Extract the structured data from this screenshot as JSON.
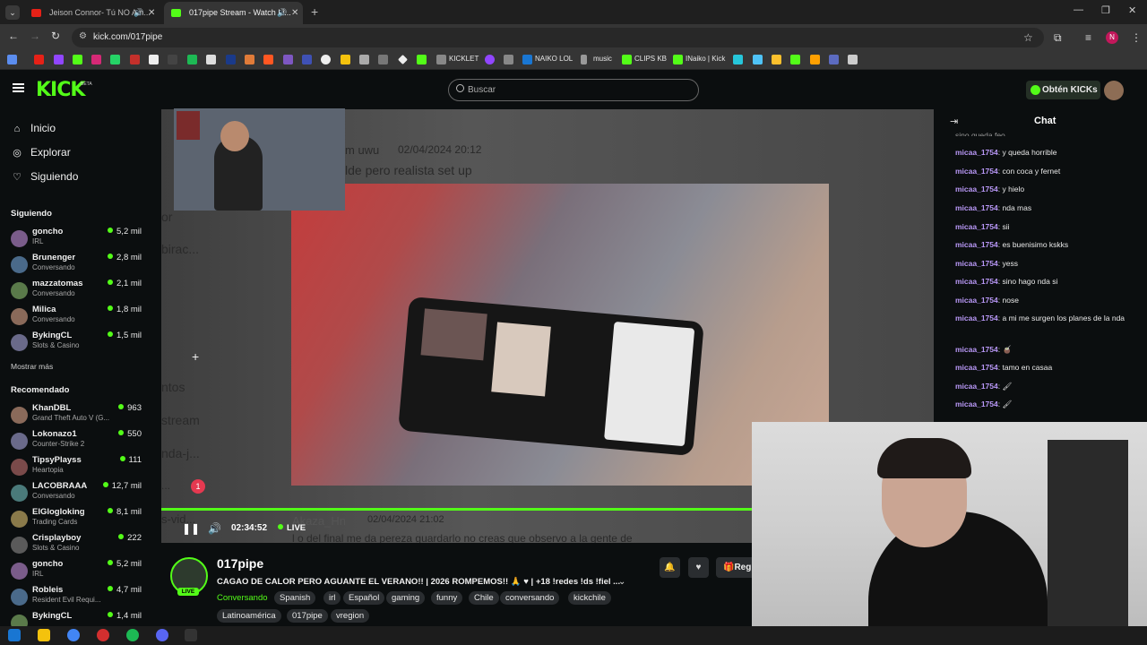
{
  "browser": {
    "tabs": [
      {
        "title": "Jeison Connor- Tú NO Am..."
      },
      {
        "title": "017pipe Stream - Watch Li..."
      }
    ],
    "url": "kick.com/017pipe",
    "bookmarks": [
      "KICKLET",
      "NAIKO LOL",
      "music",
      "CLIPS KB",
      "INaiko | Kick"
    ],
    "user_initial": "N"
  },
  "kick": {
    "logo": "KICK",
    "beta": "BETA",
    "search_placeholder": "Buscar",
    "get_kicks": "Obtén KICKs",
    "nav": [
      "Inicio",
      "Explorar",
      "Siguiendo"
    ],
    "following_header": "Siguiendo",
    "following": [
      {
        "name": "goncho",
        "category": "IRL",
        "viewers": "5,2 mil"
      },
      {
        "name": "Brunenger",
        "category": "Conversando",
        "viewers": "2,8 mil"
      },
      {
        "name": "mazzatomas",
        "category": "Conversando",
        "viewers": "2,1 mil"
      },
      {
        "name": "Milica",
        "category": "Conversando",
        "viewers": "1,8 mil"
      },
      {
        "name": "BykingCL",
        "category": "Slots & Casino",
        "viewers": "1,5 mil"
      }
    ],
    "show_more": "Mostrar más",
    "recommended_header": "Recomendado",
    "recommended": [
      {
        "name": "KhanDBL",
        "category": "Grand Theft Auto V (G...",
        "viewers": "963"
      },
      {
        "name": "Lokonazo1",
        "category": "Counter-Strike 2",
        "viewers": "550"
      },
      {
        "name": "TipsyPlayss",
        "category": "Heartopia",
        "viewers": "111"
      },
      {
        "name": "LACOBRAAA",
        "category": "Conversando",
        "viewers": "12,7 mil"
      },
      {
        "name": "ElGlogloking",
        "category": "Trading Cards",
        "viewers": "8,1 mil"
      },
      {
        "name": "Crisplayboy",
        "category": "Slots & Casino",
        "viewers": "222"
      },
      {
        "name": "goncho",
        "category": "IRL",
        "viewers": "5,2 mil"
      },
      {
        "name": "Robleis",
        "category": "Resident Evil Requi...",
        "viewers": "4,7 mil"
      },
      {
        "name": "BykingCL",
        "category": "",
        "viewers": "1,4 mil"
      }
    ]
  },
  "player": {
    "overlay_texts": [
      "m uwu",
      "02/04/2024 20:12",
      "lde pero realista set up",
      "or",
      "birac...",
      "ntos",
      "stream",
      "nda-j...",
      "...",
      "1",
      "s-vid...",
      "Akaza_Hn",
      "02/04/2024 21:02",
      "l o del final me da pereza guardarlo no creas que observo a la gente de"
    ],
    "timecode": "02:34:52",
    "live": "LIVE",
    "progress": 1.0
  },
  "stream": {
    "channel": "017pipe",
    "avatar_live": "LIVE",
    "title": "CAGAO DE CALOR PERO AGUANTE EL VERANO!! | 2026 ROMPEMOS!! 🙏 ♥ | +18 !redes !ds !fiel ...",
    "category": "Conversando",
    "tags": [
      "Spanish",
      "irl",
      "Español",
      "gaming",
      "funny",
      "Chile",
      "conversando",
      "kickchile",
      "Latinoamérica",
      "017pipe",
      "vregion"
    ],
    "reg_label": "Reg"
  },
  "chat": {
    "header": "Chat",
    "partial_top": "sino queda feo",
    "messages": [
      {
        "user": "micaa_1754",
        "text": "y queda horrible"
      },
      {
        "user": "micaa_1754",
        "text": "con coca y fernet"
      },
      {
        "user": "micaa_1754",
        "text": "y hielo"
      },
      {
        "user": "micaa_1754",
        "text": "nda mas"
      },
      {
        "user": "micaa_1754",
        "text": "sii"
      },
      {
        "user": "micaa_1754",
        "text": "es buenisimo kskks"
      },
      {
        "user": "micaa_1754",
        "text": "yess"
      },
      {
        "user": "micaa_1754",
        "text": "sino hago nda si"
      },
      {
        "user": "micaa_1754",
        "text": "nose"
      },
      {
        "user": "micaa_1754",
        "text": "a mi me surgen los planes de la nda"
      },
      {
        "user": "micaa_1754",
        "text": "🧉"
      },
      {
        "user": "micaa_1754",
        "text": "tamo en casaa"
      },
      {
        "user": "micaa_1754",
        "text": "🖌"
      },
      {
        "user": "micaa_1754",
        "text": "🖌"
      }
    ]
  },
  "colors": {
    "accent": "#53fc18",
    "bg": "#0b0e0f",
    "chat_user": "#b998f7"
  }
}
